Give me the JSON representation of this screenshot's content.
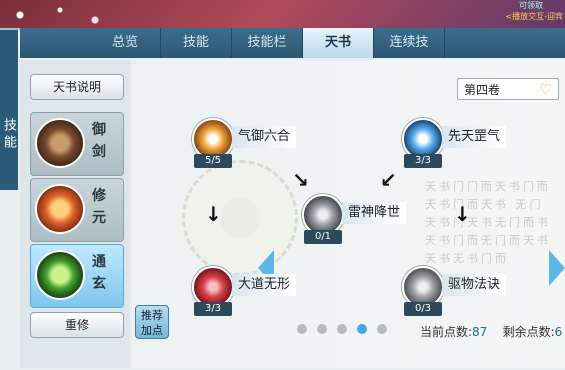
{
  "header": {
    "side_title": "技能",
    "badge": "可领取",
    "quest_hint": "<播放交互-迎宾"
  },
  "tabs": [
    {
      "label": "总览",
      "active": false
    },
    {
      "label": "技能",
      "active": false
    },
    {
      "label": "技能栏",
      "active": false
    },
    {
      "label": "天书",
      "active": true
    },
    {
      "label": "连续技",
      "active": false
    }
  ],
  "left_panel": {
    "info_button": "天书说明",
    "paths": [
      {
        "label": "御剑",
        "color": "#7a4a2e",
        "active": false
      },
      {
        "label": "修元",
        "color": "#e0622a",
        "active": false
      },
      {
        "label": "通玄",
        "color": "#3f9b2d",
        "active": true
      }
    ],
    "reset_button": "重修",
    "recommend_button": "推荐加点"
  },
  "volume": {
    "selected": "第四卷"
  },
  "skills": [
    {
      "name": "气御六合",
      "count": "5/5",
      "color": "#e07a1e"
    },
    {
      "name": "先天罡气",
      "count": "3/3",
      "color": "#2a7ac0"
    },
    {
      "name": "雷神降世",
      "count": "0/1",
      "color": "#7a7f86"
    },
    {
      "name": "大道无形",
      "count": "3/3",
      "color": "#c8323c"
    },
    {
      "name": "驱物法诀",
      "count": "0/3",
      "color": "#8a8f96"
    }
  ],
  "book_text": "天书门门而天书门而天书门而天书\n无门天书门天书无门而书\n天书门而无门而天书天书无书门而",
  "pagination": {
    "total": 5,
    "current": 4
  },
  "points": {
    "current_label": "当前点数:",
    "current_value": "87",
    "remaining_label": "剩余点数:",
    "remaining_value": "6"
  }
}
